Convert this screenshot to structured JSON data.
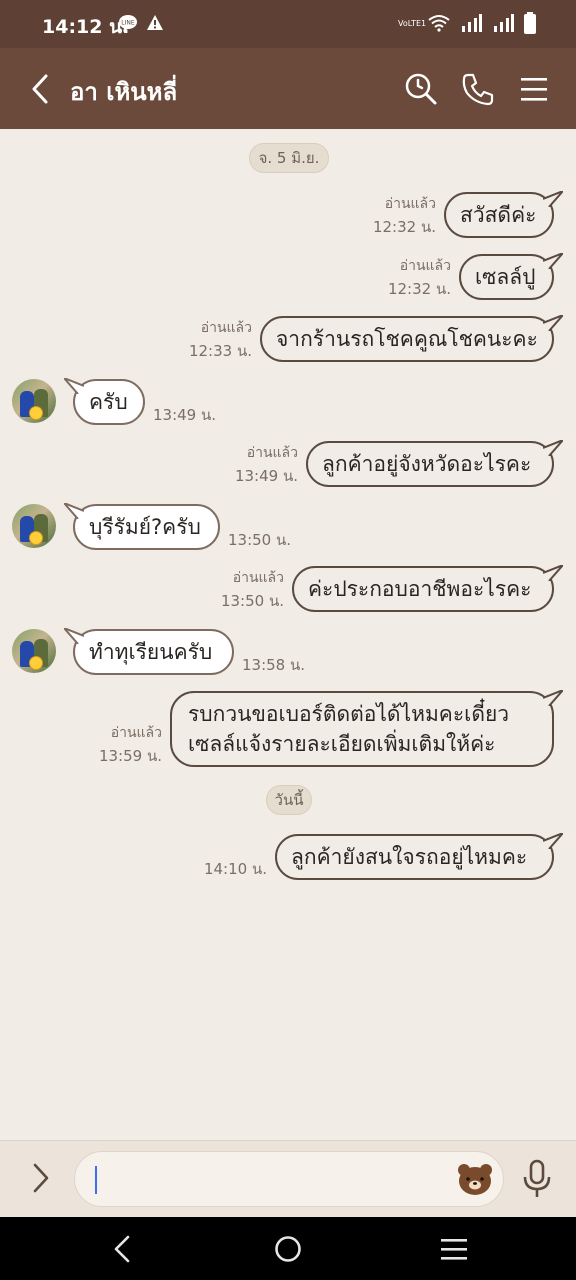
{
  "status": {
    "time": "14:12 น.",
    "network": "VoLTE1"
  },
  "header": {
    "title": "อา เหินหลี่"
  },
  "dates": {
    "first": "จ. 5 มิ.ย.",
    "today": "วันนี้"
  },
  "messages": [
    {
      "dir": "out",
      "text": "สวัสดีค่ะ",
      "read": "อ่านแล้ว",
      "time": "12:32 น."
    },
    {
      "dir": "out",
      "text": "เซลล์ปู",
      "read": "อ่านแล้ว",
      "time": "12:32 น."
    },
    {
      "dir": "out",
      "text": "จากร้านรถโชคคูณโชคนะคะ",
      "read": "อ่านแล้ว",
      "time": "12:33 น."
    },
    {
      "dir": "in",
      "text": "ครับ",
      "time": "13:49 น."
    },
    {
      "dir": "out",
      "text": "ลูกค้าอยู่จังหวัดอะไรคะ",
      "read": "อ่านแล้ว",
      "time": "13:49 น."
    },
    {
      "dir": "in",
      "text": "บุรีรัมย์?ครับ",
      "time": "13:50 น."
    },
    {
      "dir": "out",
      "text": "ค่ะประกอบอาชีพอะไรคะ",
      "read": "อ่านแล้ว",
      "time": "13:50 น."
    },
    {
      "dir": "in",
      "text": "ทำทุเรียนครับ",
      "time": "13:58 น."
    },
    {
      "dir": "out",
      "text": "รบกวนขอเบอร์ติดต่อได้ไหมคะเดี๋ยวเซลล์แจ้งรายละเอียดเพิ่มเติมให้ค่ะ",
      "read": "อ่านแล้ว",
      "time": "13:59 น."
    },
    {
      "dir": "out",
      "text": "ลูกค้ายังสนใจรถอยู่ไหมคะ",
      "time": "14:10 น."
    }
  ],
  "composer": {
    "text": ""
  },
  "colors": {
    "header": "#6b4a3b",
    "statusbar": "#5e4134",
    "background": "#f1ece6"
  }
}
